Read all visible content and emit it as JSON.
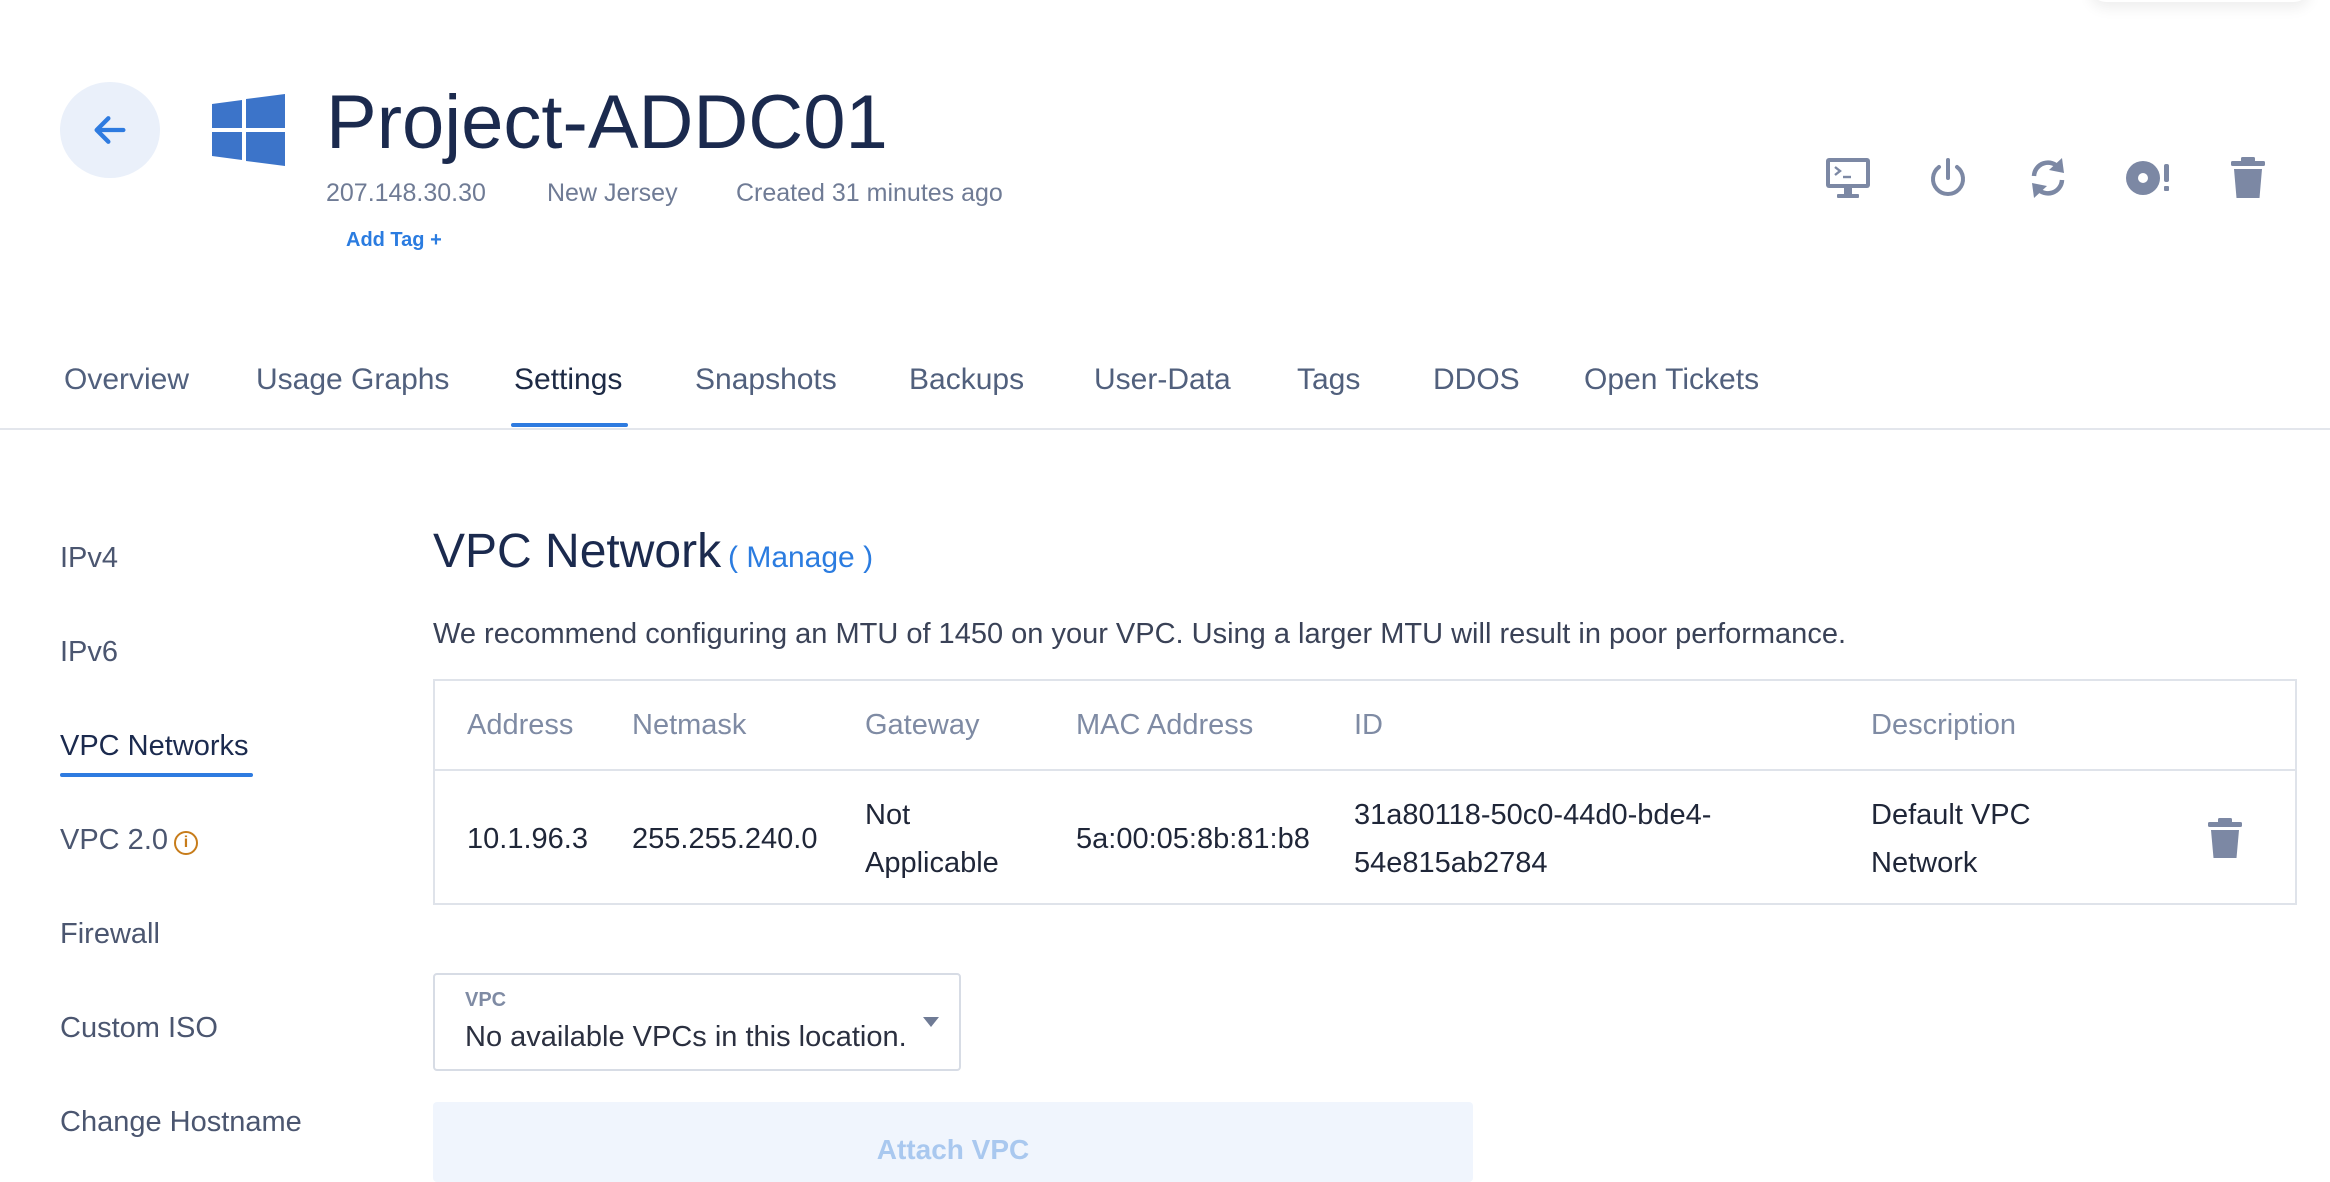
{
  "header": {
    "title": "Project-ADDC01",
    "ip": "207.148.30.30",
    "location": "New Jersey",
    "created": "Created 31 minutes ago",
    "add_tag": "Add Tag +",
    "actions": [
      "console-icon",
      "power-icon",
      "restart-icon",
      "reinstall-icon",
      "trash-icon"
    ]
  },
  "tabs": [
    {
      "label": "Overview"
    },
    {
      "label": "Usage Graphs"
    },
    {
      "label": "Settings",
      "active": true
    },
    {
      "label": "Snapshots"
    },
    {
      "label": "Backups"
    },
    {
      "label": "User-Data"
    },
    {
      "label": "Tags"
    },
    {
      "label": "DDOS"
    },
    {
      "label": "Open Tickets"
    }
  ],
  "sidebar": {
    "items": [
      {
        "label": "IPv4"
      },
      {
        "label": "IPv6"
      },
      {
        "label": "VPC Networks",
        "active": true
      },
      {
        "label": "VPC 2.0"
      },
      {
        "label": "Firewall"
      },
      {
        "label": "Custom ISO"
      },
      {
        "label": "Change Hostname"
      }
    ]
  },
  "main": {
    "title": "VPC Network",
    "manage": "( Manage )",
    "note": "We recommend configuring an MTU of 1450 on your VPC. Using a larger MTU will result in poor performance.",
    "table": {
      "headers": [
        "Address",
        "Netmask",
        "Gateway",
        "MAC Address",
        "ID",
        "Description"
      ],
      "row": {
        "address": "10.1.96.3",
        "netmask": "255.255.240.0",
        "gateway_1": "Not",
        "gateway_2": "Applicable",
        "mac": "5a:00:05:8b:81:b8",
        "id_1": "31a80118-50c0-44d0-bde4-",
        "id_2": "54e815ab2784",
        "description_1": "Default VPC",
        "description_2": "Network"
      }
    },
    "vpc_select": {
      "label": "VPC",
      "value": "No available VPCs in this location."
    },
    "attach_button": "Attach VPC"
  },
  "colors": {
    "accent": "#2e7be0",
    "title": "#1b2a4e",
    "muted": "#6f7b95",
    "icon": "#7c88a4"
  }
}
